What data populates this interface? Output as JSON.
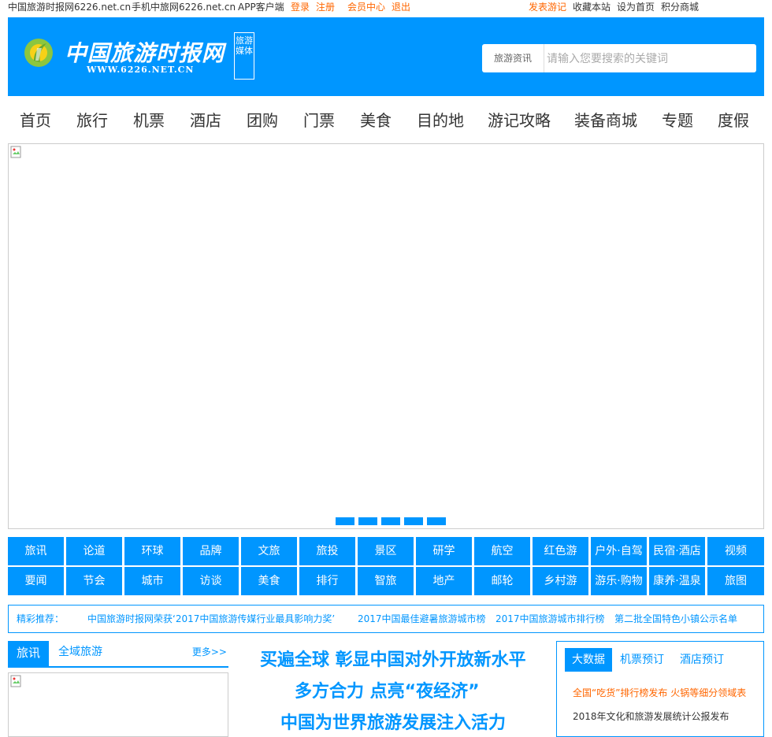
{
  "topbar": {
    "site_domain": "中国旅游时报网6226.net.cn",
    "mobile": "手机中旅网6226.net.cn",
    "app": "APP客户端",
    "login": "登录",
    "register": "注册",
    "member": "会员中心",
    "logout": "退出",
    "post": "发表游记",
    "favorite": "收藏本站",
    "homepage": "设为首页",
    "shop": "积分商城"
  },
  "header": {
    "logo_text": "中国旅游时报网",
    "logo_url": "WWW.6226.NET.CN",
    "badge": "旅游媒体",
    "search_category": "旅游资讯",
    "search_placeholder": "请输入您要搜索的关键词"
  },
  "nav": [
    "首页",
    "旅行",
    "机票",
    "酒店",
    "团购",
    "门票",
    "美食",
    "目的地",
    "游记攻略",
    "装备商城",
    "专题",
    "度假"
  ],
  "banner": {
    "slide_count": 5
  },
  "categories": {
    "row1": [
      "旅讯",
      "论道",
      "环球",
      "品牌",
      "文旅",
      "旅投",
      "景区",
      "研学",
      "航空",
      "红色游",
      "户外·自驾",
      "民宿·酒店",
      "视频"
    ],
    "row2": [
      "要闻",
      "节会",
      "城市",
      "访谈",
      "美食",
      "排行",
      "智旅",
      "地产",
      "邮轮",
      "乡村游",
      "游乐·购物",
      "康养·温泉",
      "旅图"
    ]
  },
  "recommend": {
    "label": "精彩推荐：",
    "items": [
      "中国旅游时报网荣获‘2017中国旅游传媒行业最具影响力奖’",
      "2017中国最佳避暑旅游城市榜",
      "2017中国旅游城市排行榜",
      "第二批全国特色小镇公示名单"
    ]
  },
  "left": {
    "tab_active": "旅讯",
    "tab": "全域旅游",
    "more": "更多>>"
  },
  "headlines": [
    "买遍全球 彰显中国对外开放新水平",
    "多方合力 点亮“夜经济”",
    "中国为世界旅游发展注入活力"
  ],
  "right": {
    "tabs": [
      "大数据",
      "机票预订",
      "酒店预订"
    ],
    "links": [
      "全国“吃货”排行榜发布 火锅等细分领域表",
      "2018年文化和旅游发展统计公报发布"
    ]
  },
  "colors": {
    "brand": "#0096ff",
    "accent": "#ff6600"
  }
}
